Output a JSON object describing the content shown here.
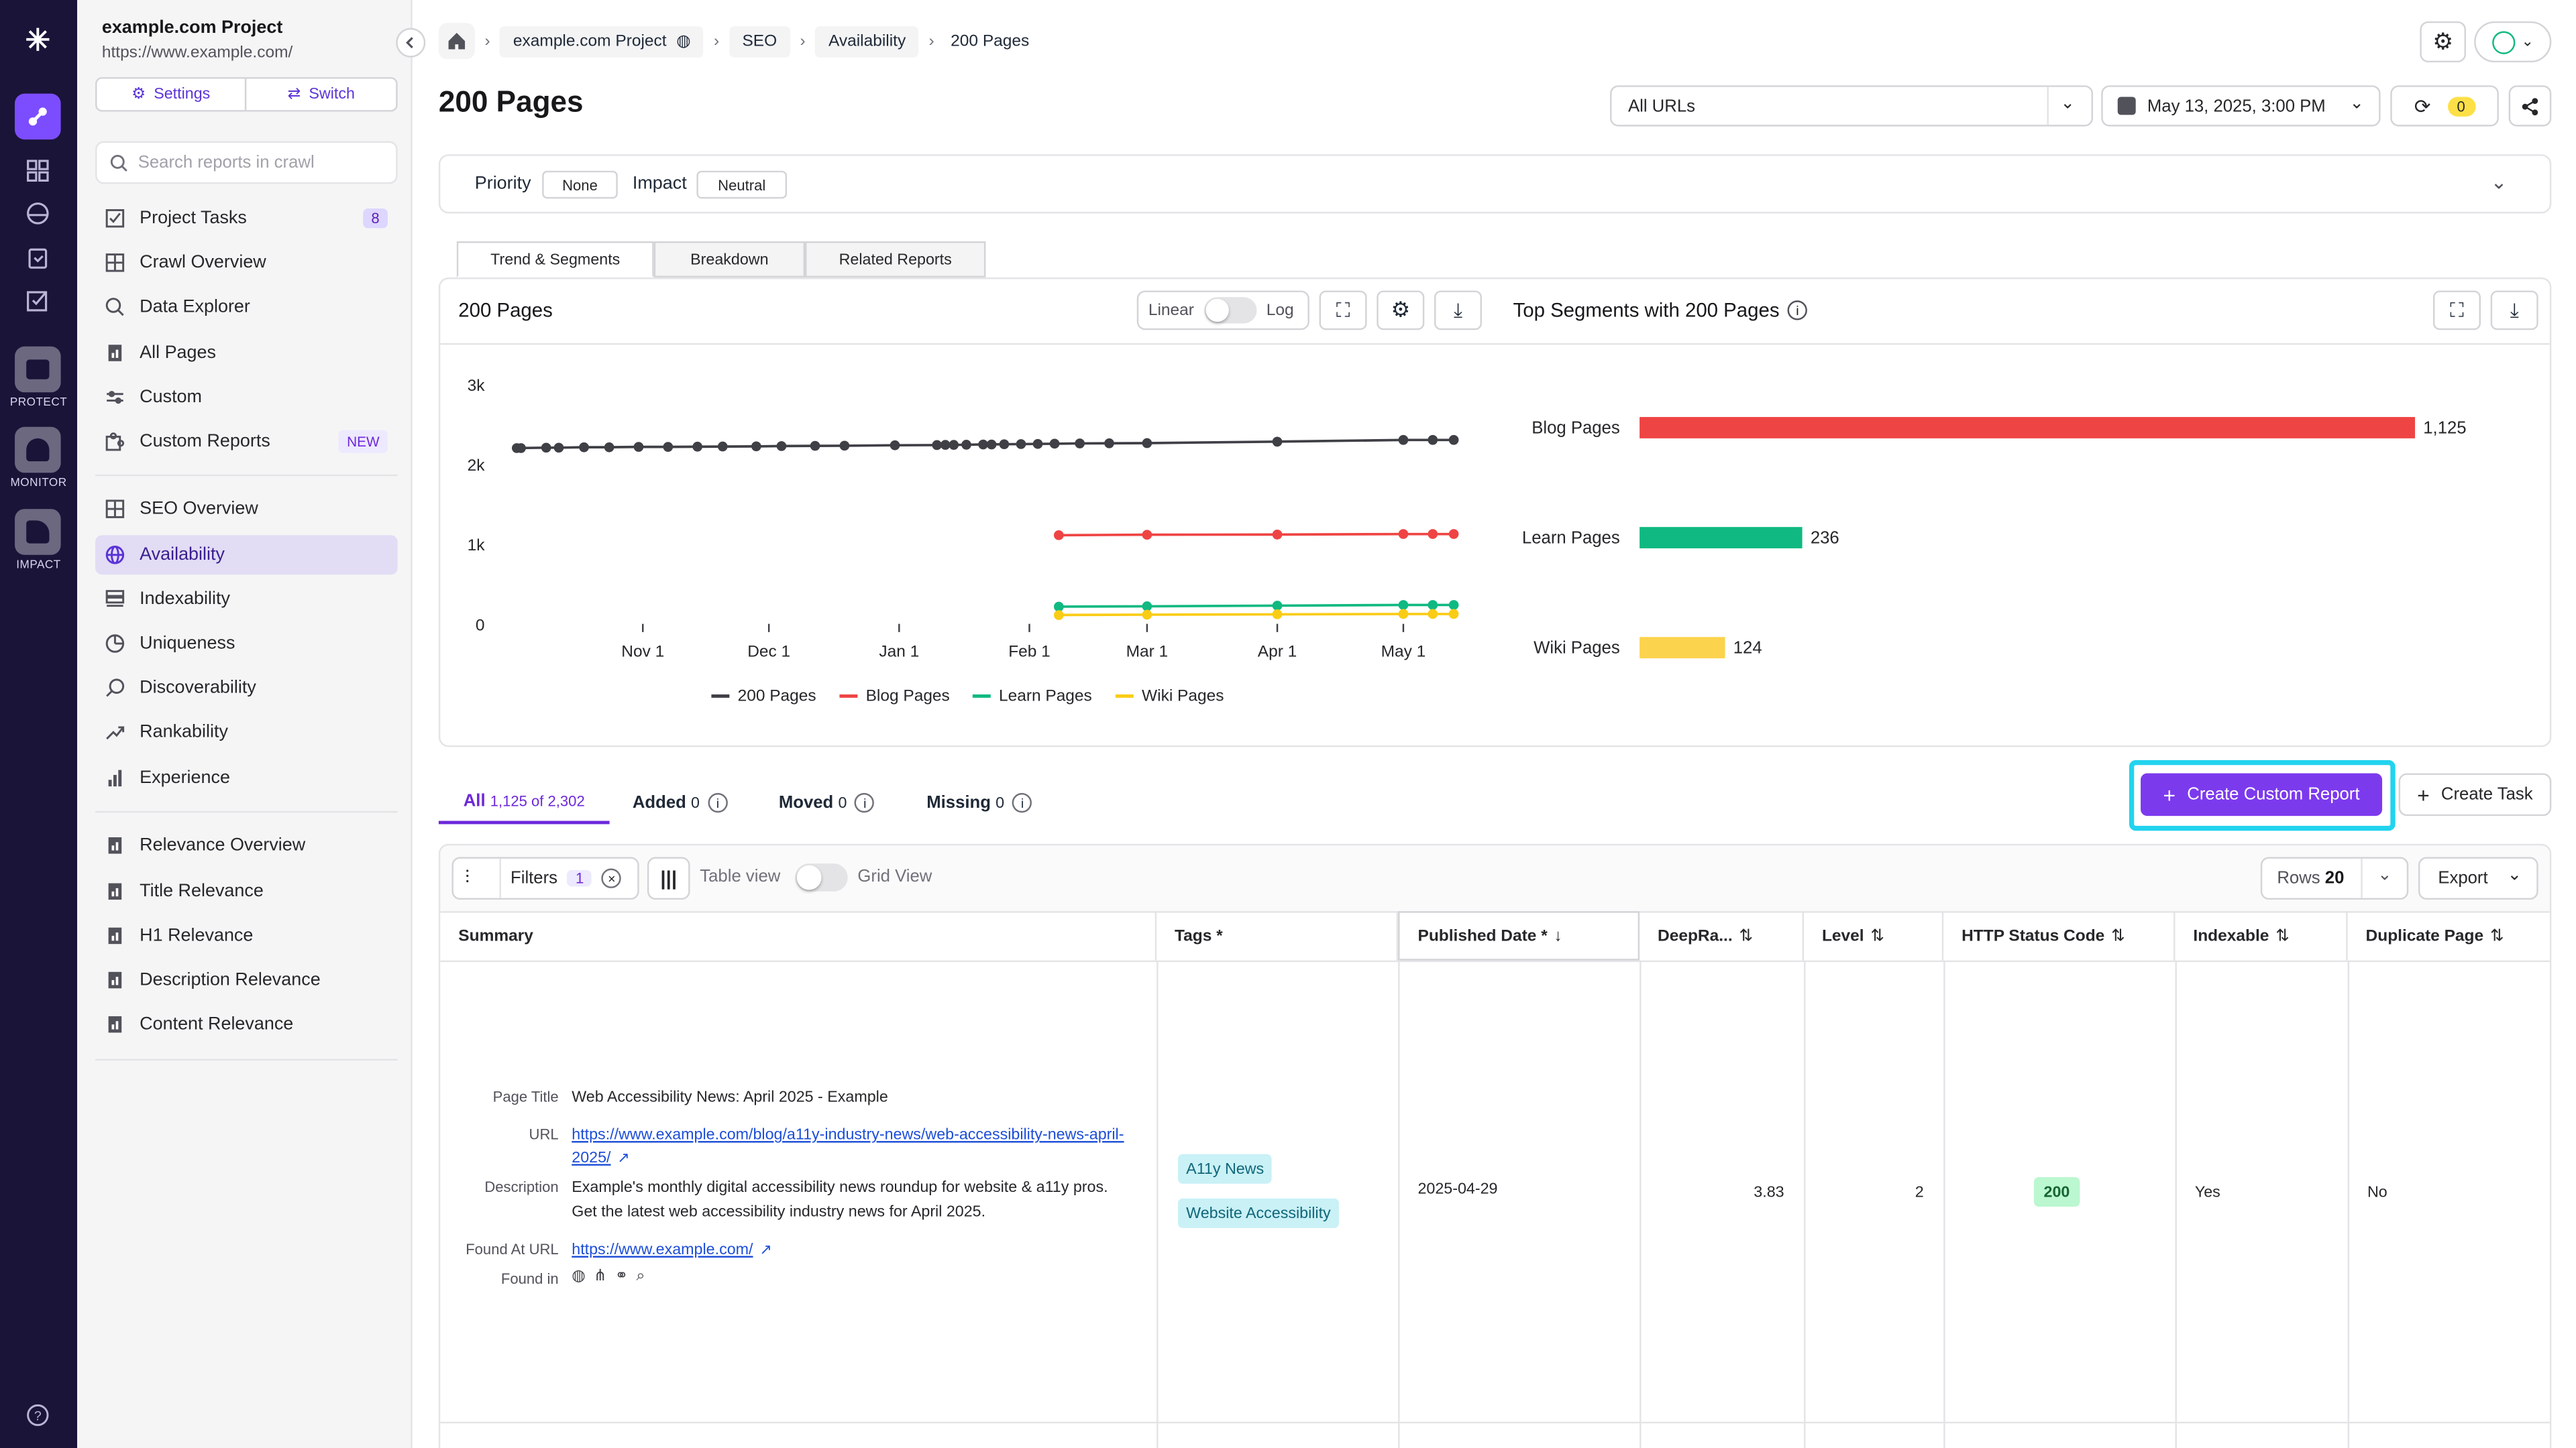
{
  "project": {
    "name": "example.com Project",
    "url": "https://www.example.com/"
  },
  "rail": {
    "labels": [
      "PROTECT",
      "MONITOR",
      "IMPACT"
    ]
  },
  "sidebar": {
    "settings_label": "Settings",
    "switch_label": "Switch",
    "search_placeholder": "Search reports in crawl",
    "items": [
      {
        "label": "Project Tasks",
        "badge": "8"
      },
      {
        "label": "Crawl Overview"
      },
      {
        "label": "Data Explorer"
      },
      {
        "label": "All Pages"
      },
      {
        "label": "Custom"
      },
      {
        "label": "Custom Reports",
        "badge": "NEW"
      }
    ],
    "seo_items": [
      {
        "label": "SEO Overview"
      },
      {
        "label": "Availability"
      },
      {
        "label": "Indexability"
      },
      {
        "label": "Uniqueness"
      },
      {
        "label": "Discoverability"
      },
      {
        "label": "Rankability"
      },
      {
        "label": "Experience"
      }
    ],
    "relevance_items": [
      {
        "label": "Relevance Overview"
      },
      {
        "label": "Title Relevance"
      },
      {
        "label": "H1 Relevance"
      },
      {
        "label": "Description Relevance"
      },
      {
        "label": "Content Relevance"
      }
    ]
  },
  "breadcrumb": [
    "example.com Project",
    "SEO",
    "Availability",
    "200 Pages"
  ],
  "page_title": "200 Pages",
  "url_filter": "All URLs",
  "crawl_date": "May 13, 2025, 3:00 PM",
  "refresh_count": "0",
  "priority": {
    "label": "Priority",
    "value": "None"
  },
  "impact": {
    "label": "Impact",
    "value": "Neutral"
  },
  "tabs": [
    "Trend & Segments",
    "Breakdown",
    "Related Reports"
  ],
  "trend": {
    "title": "200 Pages",
    "scale_linear": "Linear",
    "scale_log": "Log"
  },
  "segments_title": "Top Segments with 200 Pages",
  "chart_data": [
    {
      "type": "line",
      "yticks": [
        "0",
        "1k",
        "2k",
        "3k"
      ],
      "ylim": [
        0,
        3000
      ],
      "xticks": [
        "Nov 1",
        "Dec 1",
        "Jan 1",
        "Feb 1",
        "Mar 1",
        "Apr 1",
        "May 1"
      ],
      "series": [
        {
          "name": "200 Pages",
          "color": "#3f3f46",
          "points": [
            [
              "2024-10-02",
              2200
            ],
            [
              "2024-10-03",
              2200
            ],
            [
              "2024-10-09",
              2205
            ],
            [
              "2024-10-12",
              2205
            ],
            [
              "2024-10-18",
              2210
            ],
            [
              "2024-10-24",
              2210
            ],
            [
              "2024-10-31",
              2215
            ],
            [
              "2024-11-07",
              2215
            ],
            [
              "2024-11-14",
              2218
            ],
            [
              "2024-11-20",
              2220
            ],
            [
              "2024-11-28",
              2222
            ],
            [
              "2024-12-04",
              2225
            ],
            [
              "2024-12-12",
              2228
            ],
            [
              "2024-12-19",
              2230
            ],
            [
              "2024-12-31",
              2235
            ],
            [
              "2025-01-10",
              2238
            ],
            [
              "2025-01-12",
              2240
            ],
            [
              "2025-01-14",
              2240
            ],
            [
              "2025-01-17",
              2242
            ],
            [
              "2025-01-21",
              2245
            ],
            [
              "2025-01-23",
              2245
            ],
            [
              "2025-01-26",
              2248
            ],
            [
              "2025-01-30",
              2250
            ],
            [
              "2025-02-03",
              2252
            ],
            [
              "2025-02-07",
              2255
            ],
            [
              "2025-02-13",
              2258
            ],
            [
              "2025-02-20",
              2260
            ],
            [
              "2025-03-01",
              2262
            ],
            [
              "2025-04-01",
              2280
            ],
            [
              "2025-05-01",
              2302
            ],
            [
              "2025-05-08",
              2302
            ],
            [
              "2025-05-13",
              2302
            ]
          ]
        },
        {
          "name": "Blog Pages",
          "color": "#ef4444",
          "points": [
            [
              "2025-02-08",
              1110
            ],
            [
              "2025-03-01",
              1115
            ],
            [
              "2025-04-01",
              1118
            ],
            [
              "2025-05-01",
              1125
            ],
            [
              "2025-05-08",
              1125
            ],
            [
              "2025-05-13",
              1125
            ]
          ]
        },
        {
          "name": "Learn Pages",
          "color": "#10b981",
          "points": [
            [
              "2025-02-08",
              215
            ],
            [
              "2025-03-01",
              220
            ],
            [
              "2025-04-01",
              228
            ],
            [
              "2025-05-01",
              236
            ],
            [
              "2025-05-08",
              236
            ],
            [
              "2025-05-13",
              236
            ]
          ]
        },
        {
          "name": "Wiki Pages",
          "color": "#facc15",
          "points": [
            [
              "2025-02-08",
              110
            ],
            [
              "2025-03-01",
              115
            ],
            [
              "2025-04-01",
              120
            ],
            [
              "2025-05-01",
              124
            ],
            [
              "2025-05-08",
              124
            ],
            [
              "2025-05-13",
              124
            ]
          ]
        }
      ]
    },
    {
      "type": "bar",
      "categories": [
        "Blog Pages",
        "Learn Pages",
        "Wiki Pages"
      ],
      "values": [
        1125,
        236,
        124
      ],
      "value_labels": [
        "1,125",
        "236",
        "124"
      ],
      "colors": [
        "#ef4444",
        "#10b981",
        "#fcd34d"
      ]
    }
  ],
  "diff_tabs": {
    "all_label": "All",
    "all_count": "1,125 of 2,302",
    "added_label": "Added",
    "added_count": "0",
    "moved_label": "Moved",
    "moved_count": "0",
    "missing_label": "Missing",
    "missing_count": "0"
  },
  "actions": {
    "create_custom_report": "Create Custom Report",
    "create_task": "Create Task"
  },
  "toolbar": {
    "filters_label": "Filters",
    "filters_count": "1",
    "table_view": "Table view",
    "grid_view": "Grid View",
    "rows_label": "Rows",
    "rows_value": "20",
    "export_label": "Export"
  },
  "table": {
    "columns": [
      "Summary",
      "Tags *",
      "Published Date *",
      "DeepRa...",
      "Level",
      "HTTP Status Code",
      "Indexable",
      "Duplicate Page"
    ],
    "row": {
      "page_title_label": "Page Title",
      "page_title": "Web Accessibility News: April 2025 - Example",
      "url_label": "URL",
      "url_line1": "https://www.example.com/blog/a11y-industry-news/web-accessibility-news-april-",
      "url_line2": "2025/",
      "description_label": "Description",
      "description_line1": "Example's monthly digital accessibility news roundup for website & a11y pros.",
      "description_line2": "Get the latest web accessibility industry news for April 2025.",
      "found_at_label": "Found At URL",
      "found_at_url": "https://www.example.com/",
      "found_in_label": "Found in",
      "tags": [
        "A11y News",
        "Website Accessibility"
      ],
      "published_date": "2025-04-29",
      "deeprank": "3.83",
      "level": "2",
      "http_status": "200",
      "indexable": "Yes",
      "duplicate_page": "No"
    }
  }
}
